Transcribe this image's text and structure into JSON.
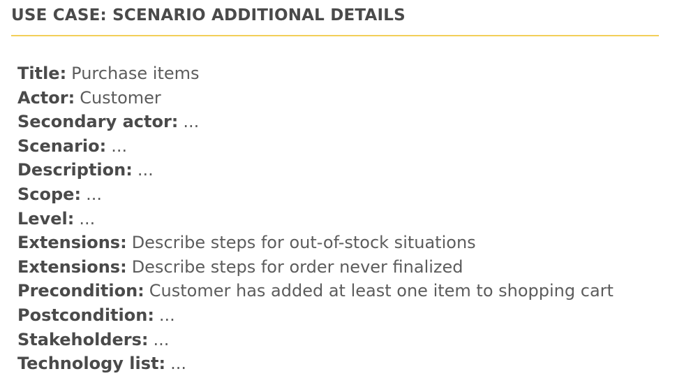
{
  "slide": {
    "heading": "USE CASE: SCENARIO ADDITIONAL DETAILS",
    "accent_color": "#f2cf59",
    "fields": [
      {
        "label": "Title:",
        "value": "Purchase items"
      },
      {
        "label": "Actor:",
        "value": "Customer"
      },
      {
        "label": "Secondary actor:",
        "value": "..."
      },
      {
        "label": "Scenario:",
        "value": "..."
      },
      {
        "label": "Description:",
        "value": "..."
      },
      {
        "label": "Scope:",
        "value": "..."
      },
      {
        "label": "Level:",
        "value": "..."
      },
      {
        "label": "Extensions:",
        "value": "Describe steps for out-of-stock situations"
      },
      {
        "label": "Extensions:",
        "value": "Describe steps for order never finalized"
      },
      {
        "label": "Precondition:",
        "value": "Customer has added at least one item to shopping cart"
      },
      {
        "label": "Postcondition:",
        "value": "..."
      },
      {
        "label": "Stakeholders:",
        "value": "..."
      },
      {
        "label": "Technology list:",
        "value": "..."
      }
    ]
  }
}
